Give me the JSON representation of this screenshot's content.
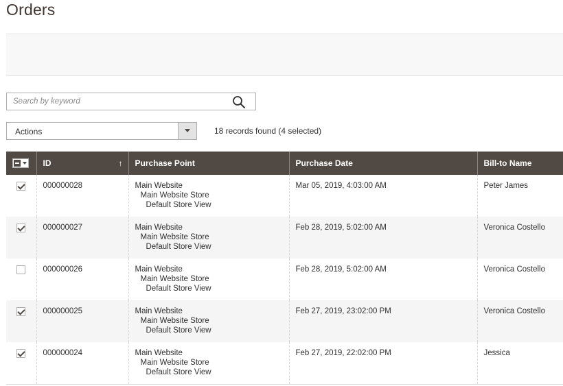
{
  "page": {
    "title": "Orders"
  },
  "search": {
    "placeholder": "Search by keyword"
  },
  "actions": {
    "label": "Actions"
  },
  "records_found": "18 records found (4 selected)",
  "table": {
    "columns": {
      "id": "ID",
      "purchase_point": "Purchase Point",
      "purchase_date": "Purchase Date",
      "bill_to_name": "Bill-to Name"
    },
    "sort_indicator": "↑",
    "rows": [
      {
        "checked": true,
        "id": "000000028",
        "pp1": "Main Website",
        "pp2": "Main Website Store",
        "pp3": "Default Store View",
        "date": "Mar 05, 2019, 4:03:00 AM",
        "bill_to": "Peter James"
      },
      {
        "checked": true,
        "id": "000000027",
        "pp1": "Main Website",
        "pp2": "Main Website Store",
        "pp3": "Default Store View",
        "date": "Feb 28, 2019, 5:02:00 AM",
        "bill_to": "Veronica Costello"
      },
      {
        "checked": false,
        "id": "000000026",
        "pp1": "Main Website",
        "pp2": "Main Website Store",
        "pp3": "Default Store View",
        "date": "Feb 28, 2019, 5:02:00 AM",
        "bill_to": "Veronica Costello"
      },
      {
        "checked": true,
        "id": "000000025",
        "pp1": "Main Website",
        "pp2": "Main Website Store",
        "pp3": "Default Store View",
        "date": "Feb 27, 2019, 23:02:00 PM",
        "bill_to": "Veronica Costello"
      },
      {
        "checked": true,
        "id": "000000024",
        "pp1": "Main Website",
        "pp2": "Main Website Store",
        "pp3": "Default Store View",
        "date": "Feb 27, 2019, 22:02:00 PM",
        "bill_to": "Jessica"
      }
    ]
  },
  "colors": {
    "header_bg": "#514943",
    "title": "#41362f",
    "row_alt": "#f5f5f5"
  }
}
